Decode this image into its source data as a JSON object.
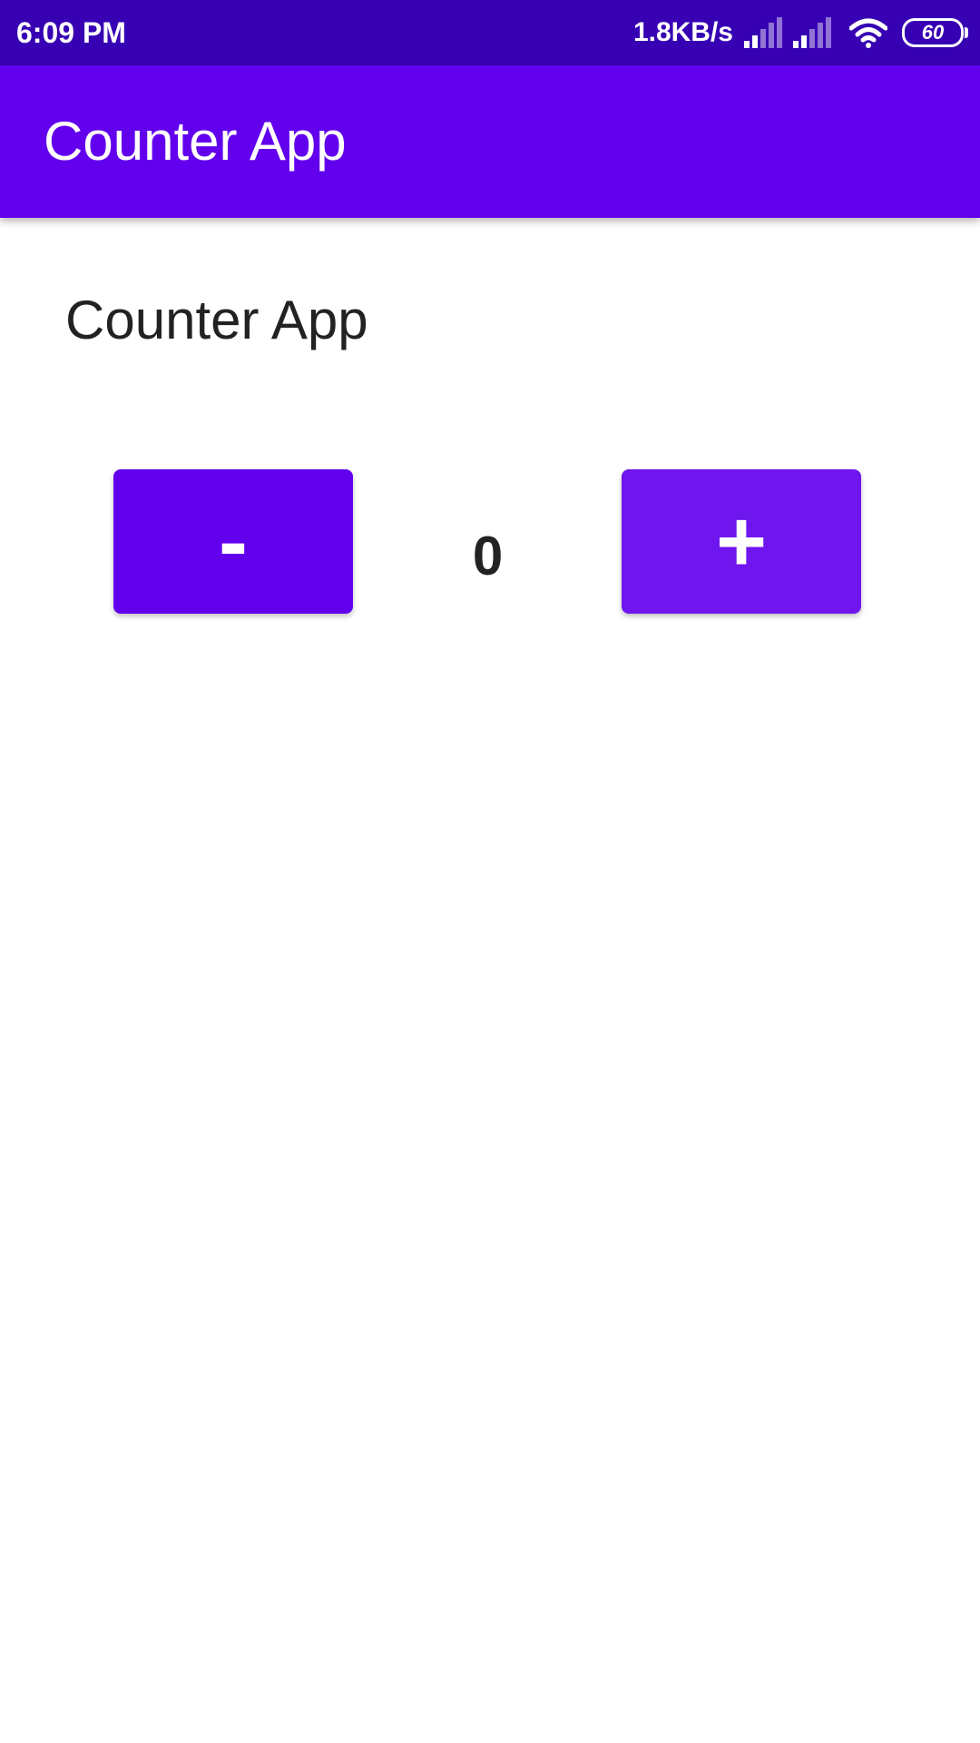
{
  "status_bar": {
    "time": "6:09 PM",
    "net_speed": "1.8KB/s",
    "battery_level": "60",
    "icons": [
      "signal-icon",
      "signal-icon",
      "wifi-icon",
      "battery-icon"
    ]
  },
  "app_bar": {
    "title": "Counter App"
  },
  "main": {
    "heading": "Counter App",
    "counter_value": "0",
    "decrement_label": "-",
    "increment_label": "+"
  },
  "colors": {
    "status_bar": "#3700b3",
    "primary": "#6200ee",
    "decrement_button": "#6200ee",
    "increment_button": "#6f15ee",
    "text": "#222222",
    "background": "#ffffff"
  }
}
